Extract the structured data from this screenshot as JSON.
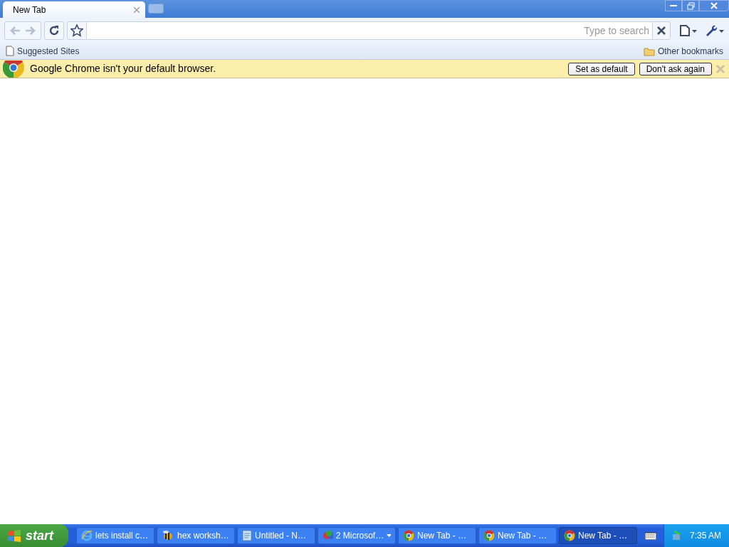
{
  "tab": {
    "title": "New Tab",
    "selected": true
  },
  "omnibox": {
    "placeholder": "Type to search"
  },
  "bookmarks_bar": {
    "items": [
      {
        "label": "Suggested Sites",
        "kind": "page"
      }
    ],
    "other": "Other bookmarks"
  },
  "infobar": {
    "message": "Google Chrome isn't your default browser.",
    "buttons": [
      "Set as default",
      "Don't ask again"
    ]
  },
  "taskbar": {
    "start": "start",
    "items": [
      {
        "label": "lets install c…",
        "kind": "ie",
        "selected": false
      },
      {
        "label": "hex worksh…",
        "kind": "hex",
        "selected": false
      },
      {
        "label": "Untitled - N…",
        "kind": "notepad",
        "selected": false
      },
      {
        "label": "2 Microsof…",
        "kind": "group",
        "selected": false
      },
      {
        "label": "New Tab - …",
        "kind": "chrome",
        "selected": false
      },
      {
        "label": "New Tab - …",
        "kind": "chrome",
        "selected": false
      },
      {
        "label": "New Tab - …",
        "kind": "chrome",
        "selected": true
      }
    ],
    "clock": "7:35 AM"
  }
}
